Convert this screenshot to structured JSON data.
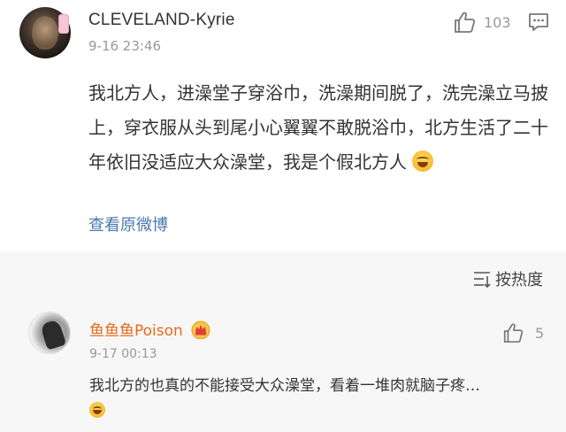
{
  "comment": {
    "username": "CLEVELAND-Kyrie",
    "time": "9-16 23:46",
    "likes": "103",
    "text": "我北方人，进澡堂子穿浴巾，洗澡期间脱了，洗完澡立马披上，穿衣服从头到尾小心翼翼不敢脱浴巾，北方生活了二十年依旧没适应大众澡堂，我是个假北方人",
    "view_original": "查看原微博"
  },
  "sort": {
    "label": "按热度"
  },
  "reply": {
    "username": "鱼鱼鱼Poison",
    "time": "9-17 00:13",
    "likes": "5",
    "text": "我北方的也真的不能接受大众澡堂，看着一堆肉就脑子疼…"
  },
  "colors": {
    "reply_username": "#e66a1e",
    "link": "#4a78b0",
    "muted": "#999999",
    "reply_bg": "#f7f7f7"
  },
  "icons": {
    "like": "thumbs-up-icon",
    "comment": "comment-bubble-icon",
    "sort": "sort-lines-icon",
    "crown": "crown-badge-icon",
    "emoji": "laughing-tears-emoji-icon"
  }
}
